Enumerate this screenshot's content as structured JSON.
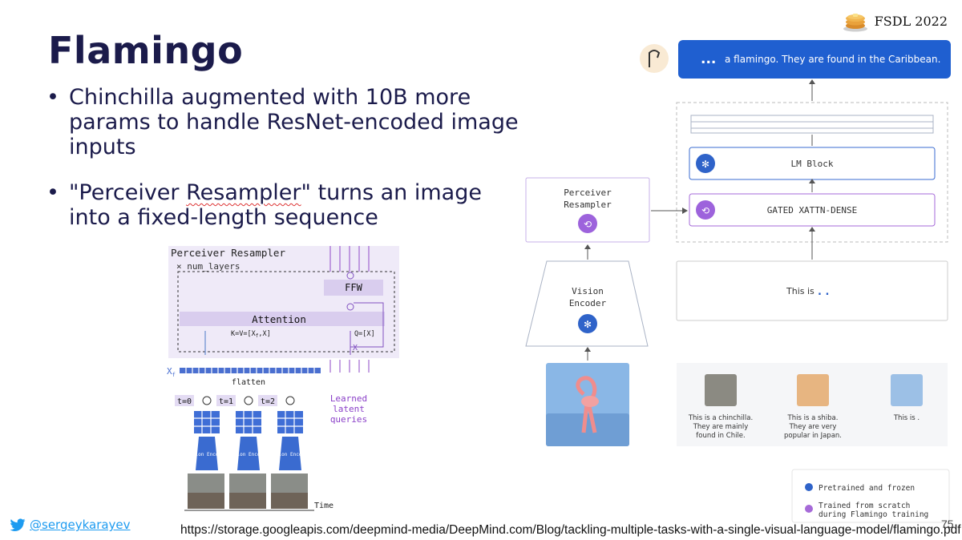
{
  "slide": {
    "title": "Flamingo",
    "bullets": [
      {
        "before": "Chinchilla augmented with 10B more params to handle ResNet-encoded image inputs",
        "flagged": "",
        "after": ""
      },
      {
        "before": "\"Perceiver ",
        "flagged": "Resampler",
        "after": "\" turns an image into a fixed-length sequence"
      }
    ],
    "brand": "FSDL 2022",
    "brand_icon": "pancake-stack-icon",
    "twitter_handle": "@sergeykarayev",
    "twitter_icon": "twitter-bird-icon",
    "source_url": "https://storage.googleapis.com/deepmind-media/DeepMind.com/Blog/tackling-multiple-tasks-with-a-single-visual-language-model/flamingo.pdf",
    "page_number": "75"
  },
  "resampler_diagram": {
    "title": "Perceiver Resampler",
    "num_layers": "num_layers",
    "ffw": "FFW",
    "attention": "Attention",
    "kv_label": "K=V=[X",
    "kv_sub": "f",
    "kv_end": ",X]",
    "q_label": "Q=[X]",
    "x_label": "X",
    "xf_label": "X",
    "xf_sub": "f",
    "flatten": "flatten",
    "timesteps": [
      "t=0",
      "t=1",
      "t=2"
    ],
    "encoder_label": "Vision Encoder",
    "learned_latent": [
      "Learned",
      "latent",
      "queries"
    ],
    "time_label": "Time"
  },
  "architecture": {
    "output_text": "a flamingo. They are found in the Caribbean.",
    "lm_block": "LM Block",
    "gated_xattn": "GATED XATTN-DENSE",
    "perceiver_line1": "Perceiver",
    "perceiver_line2": "Resampler",
    "vision_line1": "Vision",
    "vision_line2": "Encoder",
    "prompt_text": "This is",
    "examples": [
      {
        "line1": "This is a chinchilla.",
        "line2": "They are mainly",
        "line3": "found in Chile."
      },
      {
        "line1": "This is a shiba.",
        "line2": "They are very",
        "line3": "popular in Japan."
      },
      {
        "line1": "This is .",
        "line2": "",
        "line3": ""
      }
    ],
    "legend": {
      "frozen": "Pretrained and frozen",
      "trained_line1": "Trained from scratch",
      "trained_line2": "during Flamingo training"
    }
  },
  "colors": {
    "title": "#1b1b4b",
    "accent_blue": "#2d6ad6",
    "accent_purple": "#a66ad8",
    "output_bubble": "#1f5fd0"
  }
}
